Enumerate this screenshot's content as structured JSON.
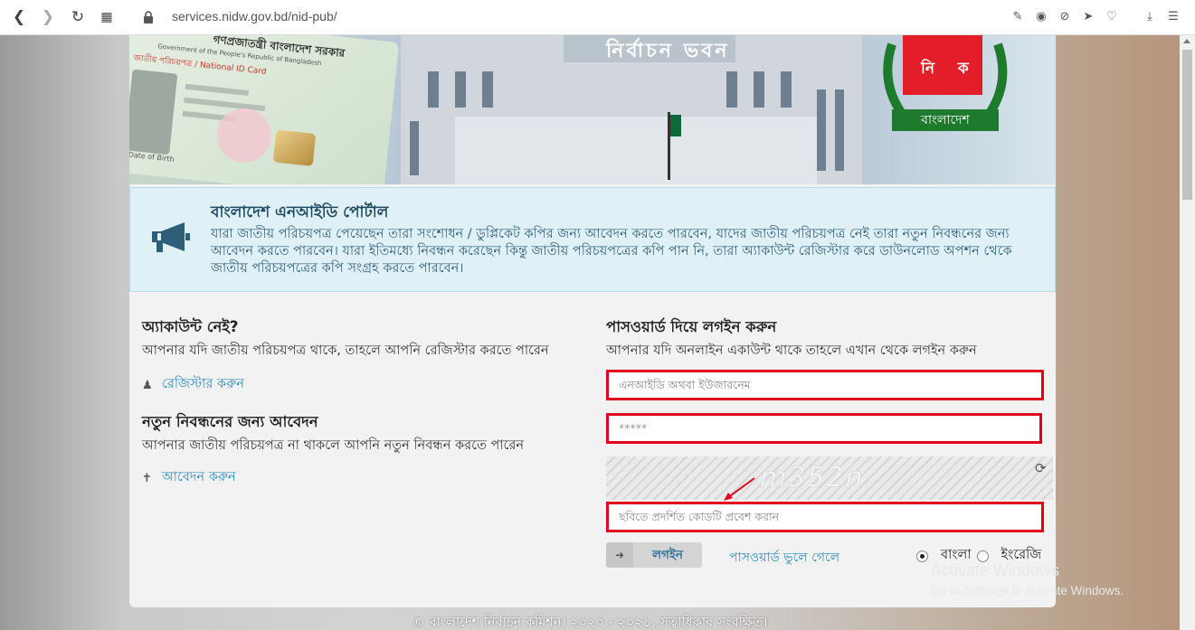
{
  "browser": {
    "url": "services.nidw.gov.bd/nid-pub/",
    "icons": [
      "back-icon",
      "forward-icon",
      "reload-icon",
      "tabs-grid-icon",
      "lock-icon",
      "edit-icon",
      "camera-icon",
      "block-icon",
      "send-icon",
      "heart-icon",
      "download-icon",
      "menu-icon"
    ]
  },
  "banner": {
    "building_sign": "নির্বাচন ভবন",
    "logo_text": "নি ক",
    "logo_band": "বাংলাদেশ",
    "card_header": "গণপ্রজাতন্ত্রী বাংলাদেশ সরকার",
    "card_subheader": "জাতীয় পরিচয়পত্র / National ID Card",
    "card_english": "Government of the People's Republic of Bangladesh",
    "card_dob": "Date of Birth"
  },
  "info": {
    "title": "বাংলাদেশ এনআইডি পোর্টাল",
    "body": "যারা জাতীয় পরিচয়পত্র পেয়েছেন তারা সংশোধন / ডুপ্লিকেট কপির জন্য আবেদন করতে পারবেন, যাদের জাতীয় পরিচয়পত্র নেই তারা নতুন নিবন্ধনের জন্য আবেদন করতে পারবেন। যারা ইতিমধ্যে নিবন্ধন করেছেন কিন্তু জাতীয় পরিচয়পত্রের কপি পান নি, তারা অ্যাকাউন্ট রেজিস্টার করে ডাউনলোড অপশন থেকে জাতীয় পরিচয়পত্রের কপি সংগ্রহ করতে পারবেন।"
  },
  "left": {
    "no_account_title": "অ্যাকাউন্ট নেই?",
    "no_account_text": "আপনার যদি জাতীয় পরিচয়পত্র থাকে, তাহলে আপনি রেজিস্টার করতে পারেন",
    "register_link": "রেজিস্টার করুন",
    "new_reg_title": "নতুন নিবন্ধনের জন্য আবেদন",
    "new_reg_text": "আপনার জাতীয় পরিচয়পত্র না থাকলে আপনি নতুন নিবন্ধন করতে পারেন",
    "apply_link": "আবেদন করুন"
  },
  "right": {
    "login_title": "পাসওয়ার্ড দিয়ে লগইন করুন",
    "login_text": "আপনার যদি অনলাইন একাউন্ট থাকে তাহলে এখান থেকে লগইন করুন",
    "username_placeholder": "এনআইডি অথবা ইউজারনেম",
    "password_placeholder": "*****",
    "captcha_code": "m352n",
    "captcha_placeholder": "ছবিতে প্রদর্শিত কোডটি প্রবেশ করান",
    "login_button": "লগইন",
    "forgot_link": "পাসওয়ার্ড ভুলে গেলে",
    "lang_bangla": "বাংলা",
    "lang_english": "ইংরেজি",
    "selected_lang": "বাংলা"
  },
  "footer": "© বাংলাদেশ নির্বাচন কমিশন। ২০২০ - ২০২১, সত্বাধিকার সংরক্ষিত।",
  "watermark": {
    "line1": "Activate Windows",
    "line2": "Go to Settings to activate Windows."
  },
  "colors": {
    "highlight_border": "#e0001b",
    "link": "#2a8abf",
    "info_bg": "#dff0f7"
  }
}
